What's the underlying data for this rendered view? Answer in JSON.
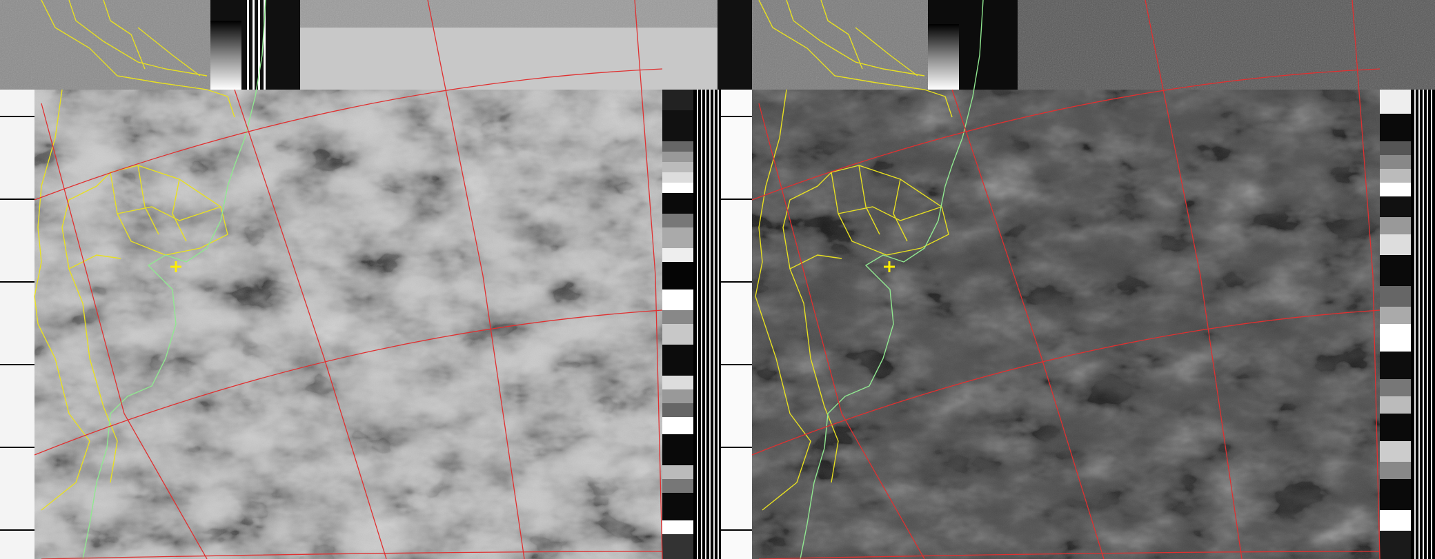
{
  "image": {
    "kind": "NOAA APT weather satellite decode, dual channel (visible + infrared)",
    "channels": [
      {
        "name": "channel-a",
        "tone": "light"
      },
      {
        "name": "channel-b",
        "tone": "dark"
      }
    ]
  },
  "overlays": {
    "graticule_color": "#e03030",
    "border_color": "#e8e020",
    "coastline_color": "#90e890",
    "station_marker_color": "#ffee00"
  }
}
